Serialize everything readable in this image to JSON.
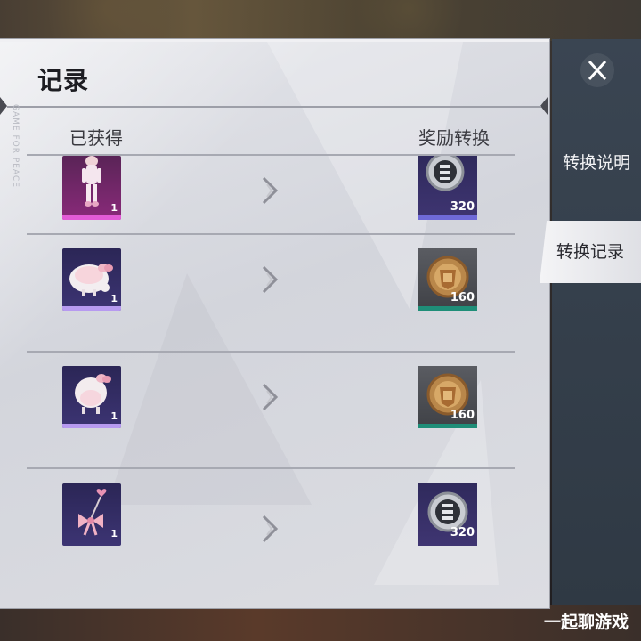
{
  "panel": {
    "title": "记录",
    "watermark": "GAME FOR PEACE"
  },
  "columns": {
    "obtained": "已获得",
    "reward_convert": "奖励转换"
  },
  "rows": [
    {
      "item_icon": "pink-outfit-icon",
      "item_count": "1",
      "reward_icon": "silver-coin-icon",
      "reward_amount": "320"
    },
    {
      "item_icon": "pink-bunny-hat-icon",
      "item_count": "1",
      "reward_icon": "gold-coin-icon",
      "reward_amount": "160"
    },
    {
      "item_icon": "pink-helmet-icon",
      "item_count": "1",
      "reward_icon": "gold-coin-icon",
      "reward_amount": "160"
    },
    {
      "item_icon": "pink-bow-charm-icon",
      "item_count": "1",
      "reward_icon": "silver-coin-icon",
      "reward_amount": "320"
    }
  ],
  "side_tabs": {
    "instructions": "转换说明",
    "records": "转换记录",
    "active": "records"
  },
  "footer": {
    "credit": "一起聊游戏"
  },
  "colors": {
    "panel_bg": "#dcdde2",
    "side_bg": "#34404c",
    "gold_bar": "#1f8e78",
    "silver_bar": "#6f6ad8"
  }
}
